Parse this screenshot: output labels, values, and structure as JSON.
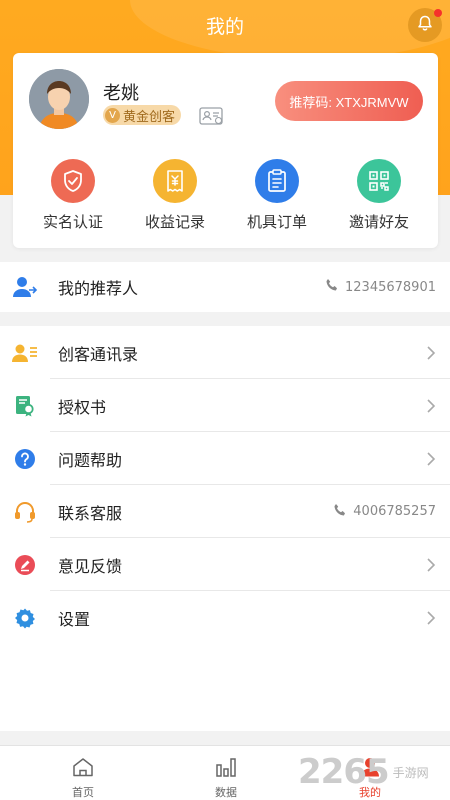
{
  "colors": {
    "header": "#ffa31c",
    "accent": "#ef5e52",
    "active_tab": "#e8412d"
  },
  "header": {
    "title": "我的",
    "bell_icon": "bell-icon"
  },
  "profile": {
    "name": "老姚",
    "level_badge_letter": "V",
    "level_badge": "黄金创客",
    "referral_code": "推荐码: XTXJRMVW"
  },
  "quick_actions": [
    {
      "label": "实名认证",
      "icon": "shield-icon",
      "color": "#ee6a54"
    },
    {
      "label": "收益记录",
      "icon": "receipt-icon",
      "color": "#f5b431"
    },
    {
      "label": "机具订单",
      "icon": "clipboard-icon",
      "color": "#2f7de9"
    },
    {
      "label": "邀请好友",
      "icon": "qrcode-icon",
      "color": "#3cc59a"
    }
  ],
  "referrer": {
    "label": "我的推荐人",
    "phone": "12345678901"
  },
  "menu": [
    {
      "label": "创客通讯录",
      "icon": "contacts-icon"
    },
    {
      "label": "授权书",
      "icon": "certificate-icon"
    },
    {
      "label": "问题帮助",
      "icon": "help-icon"
    },
    {
      "label": "联系客服",
      "icon": "headset-icon",
      "phone": "4006785257"
    },
    {
      "label": "意见反馈",
      "icon": "feedback-icon"
    },
    {
      "label": "设置",
      "icon": "gear-icon"
    }
  ],
  "tabs": [
    {
      "label": "首页",
      "icon": "home-icon"
    },
    {
      "label": "数据",
      "icon": "bar-chart-icon"
    },
    {
      "label": "我的",
      "icon": "user-icon",
      "active": true
    }
  ],
  "watermark": {
    "text": "2265",
    "sub": "手游网"
  }
}
